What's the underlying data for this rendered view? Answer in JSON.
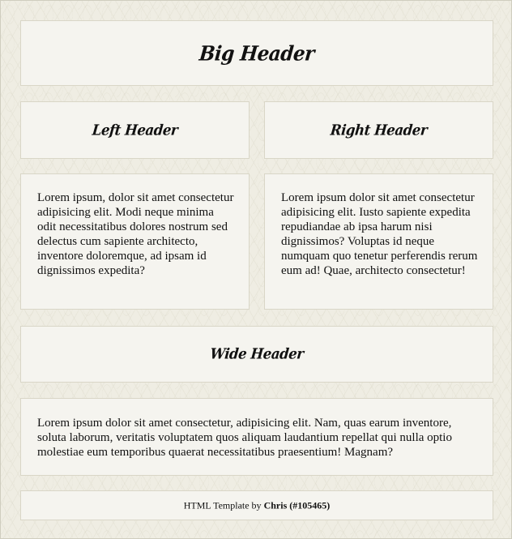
{
  "big_header": {
    "title": "Big Header"
  },
  "left_column": {
    "header": "Left Header",
    "text": "Lorem ipsum, dolor sit amet consectetur adipisicing elit. Modi neque minima odit necessitatibus dolores nostrum sed delectus cum sapiente architecto, inventore doloremque, ad ipsam id dignissimos expedita?"
  },
  "right_column": {
    "header": "Right Header",
    "text": "Lorem ipsum dolor sit amet consectetur adipisicing elit. Iusto sapiente expedita repudiandae ab ipsa harum nisi dignissimos? Voluptas id neque numquam quo tenetur perferendis rerum eum ad! Quae, architecto consectetur!"
  },
  "wide_section": {
    "header": "Wide Header",
    "text": "Lorem ipsum dolor sit amet consectetur, adipisicing elit. Nam, quas earum inventore, soluta laborum, veritatis voluptatem quos aliquam laudantium repellat qui nulla optio molestiae eum temporibus quaerat necessitatibus praesentium! Magnam?"
  },
  "footer": {
    "prefix": "HTML Template by ",
    "author": "Chris",
    "id_text": "(#105465)"
  },
  "colors": {
    "background": "#efede3",
    "panel": "#f5f4ef",
    "border": "#d9d6c7",
    "text": "#111111"
  }
}
